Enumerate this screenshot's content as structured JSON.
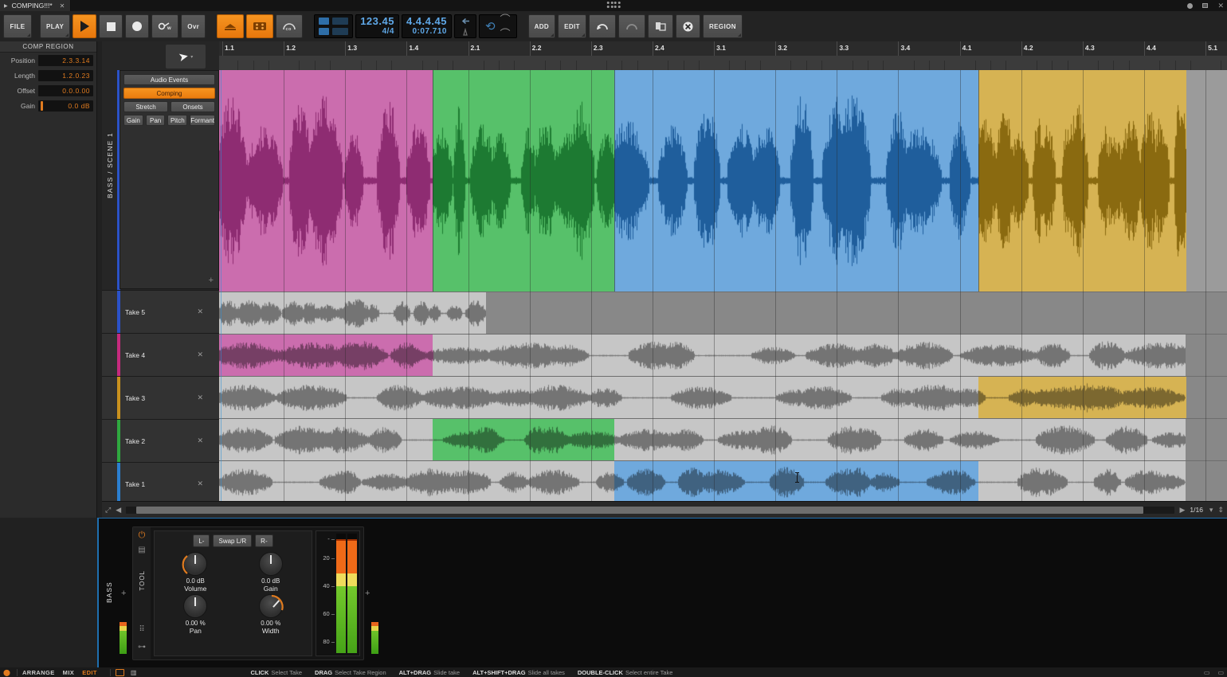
{
  "window": {
    "tab_title": "COMPING!!!*",
    "tab_close": "✕",
    "minimize": "minimize-icon",
    "maximize": "maximize-icon",
    "close": "✕"
  },
  "transport": {
    "file_label": "FILE",
    "play_menu_label": "PLAY",
    "play_icon": "play-icon",
    "stop_icon": "stop-icon",
    "record_icon": "record-icon",
    "precount_label": "w",
    "overdub_label": "Ovr",
    "layers_icon": "take-layers-icon",
    "grid_icon": "grid-editor-icon",
    "arc_icon": "arranger-icon",
    "tempo": "123.45",
    "time_signature": "4/4",
    "position_bars": "4.4.4.45",
    "position_time": "0:07.710",
    "loop_icon": "loop-icon",
    "add_label": "ADD",
    "edit_label": "EDIT",
    "undo_icon": "undo-icon",
    "redo_icon": "redo-icon",
    "duplicate_icon": "duplicate-icon",
    "cancel_icon": "cancel-icon",
    "region_label": "REGION",
    "accent_color": "#ef8a16",
    "lcd_color": "#5fa8e8"
  },
  "inspector": {
    "title": "COMP REGION",
    "fields": [
      {
        "label": "Position",
        "value": "2.3.3.14"
      },
      {
        "label": "Length",
        "value": "1.2.0.23"
      },
      {
        "label": "Offset",
        "value": "0.0.0.00"
      },
      {
        "label": "Gain",
        "value": "0.0 dB"
      }
    ],
    "value_color": "#e07b1f"
  },
  "tool_palette": {
    "buttons": [
      {
        "label": "Audio Events",
        "active": false
      },
      {
        "label": "Comping",
        "active": true
      }
    ],
    "row2": [
      {
        "label": "Stretch",
        "active": false
      },
      {
        "label": "Onsets",
        "active": false
      }
    ],
    "row3": [
      {
        "label": "Gain",
        "active": false
      },
      {
        "label": "Pan",
        "active": false
      },
      {
        "label": "Pitch",
        "active": false
      },
      {
        "label": "Formant",
        "active": false
      }
    ],
    "add_label": "+"
  },
  "track": {
    "name": "BASS / SCENE 1",
    "accent_color": "#2b52c8",
    "cursor_icon": "pointer-cursor-icon"
  },
  "takes": [
    {
      "name": "Take 5",
      "color": "#2b52c8",
      "close": "✕"
    },
    {
      "name": "Take 4",
      "color": "#c62a7e",
      "close": "✕"
    },
    {
      "name": "Take 3",
      "color": "#c9911e",
      "close": "✕"
    },
    {
      "name": "Take 2",
      "color": "#2fa83f",
      "close": "✕"
    },
    {
      "name": "Take 1",
      "color": "#2b7fd0",
      "close": "✕"
    }
  ],
  "ruler": {
    "labels": [
      "1.1",
      "1.2",
      "1.3",
      "1.4",
      "2.1",
      "2.2",
      "2.3",
      "2.4",
      "3.1",
      "3.2",
      "3.3",
      "3.4",
      "4.1",
      "4.2",
      "4.3",
      "4.4",
      "5.1"
    ]
  },
  "comp_segments": [
    {
      "take": "Take 4",
      "fill": "#cb6dae",
      "wave": "#8e2c72",
      "start_pct": 0.0,
      "end_pct": 21.2
    },
    {
      "take": "Take 2",
      "fill": "#57c16a",
      "wave": "#1d7a32",
      "start_pct": 21.2,
      "end_pct": 39.2
    },
    {
      "take": "Take 1",
      "fill": "#6fa9dd",
      "wave": "#1f5e9c",
      "start_pct": 39.2,
      "end_pct": 75.3
    },
    {
      "take": "Take 3",
      "fill": "#d6b353",
      "wave": "#8a6a10",
      "start_pct": 75.3,
      "end_pct": 95.9
    }
  ],
  "take_lanes_audio": [
    {
      "name": "Take 5",
      "clip_start_pct": 0.0,
      "clip_end_pct": 26.5,
      "active_start_pct": null,
      "active_end_pct": null,
      "fill": "#2b52c8"
    },
    {
      "name": "Take 4",
      "clip_start_pct": 0.0,
      "clip_end_pct": 95.9,
      "active_start_pct": 0.0,
      "active_end_pct": 21.2,
      "fill": "#cb6dae"
    },
    {
      "name": "Take 3",
      "clip_start_pct": 0.0,
      "clip_end_pct": 95.9,
      "active_start_pct": 75.3,
      "active_end_pct": 95.9,
      "fill": "#d6b353"
    },
    {
      "name": "Take 2",
      "clip_start_pct": 0.0,
      "clip_end_pct": 95.9,
      "active_start_pct": 21.2,
      "active_end_pct": 39.2,
      "fill": "#57c16a"
    },
    {
      "name": "Take 1",
      "clip_start_pct": 0.0,
      "clip_end_pct": 95.9,
      "active_start_pct": 39.2,
      "active_end_pct": 75.3,
      "fill": "#6fa9dd"
    }
  ],
  "scrollbar": {
    "left_icon": "◀",
    "right_icon": "▶",
    "zoom_value": "1/16",
    "zoom_caret": "▾",
    "resize_icon": "resize-icon"
  },
  "mixer": {
    "channel_name": "BASS",
    "rail_label": "TOOL",
    "power_icon": "power-icon",
    "rack_icon": "rack-icon",
    "grid_icon": "grid-icon",
    "link_icon": "link-icon",
    "buttons": [
      {
        "label": "L-"
      },
      {
        "label": "Swap L/R"
      },
      {
        "label": "R-"
      }
    ],
    "knobs": [
      {
        "value": "0.0 dB",
        "label": "Volume"
      },
      {
        "value": "0.0 dB",
        "label": "Gain"
      },
      {
        "value": "0.00 %",
        "label": "Pan"
      },
      {
        "value": "0.00 %",
        "label": "Width"
      }
    ],
    "meter_scale": [
      "20",
      "40",
      "60",
      "80"
    ],
    "meter_top_mark": "-",
    "add_left": "+",
    "add_right": "+"
  },
  "statusbar": {
    "tabs": [
      {
        "label": "ARRANGE",
        "active": false
      },
      {
        "label": "MIX",
        "active": false
      },
      {
        "label": "EDIT",
        "active": true
      }
    ],
    "hints": [
      {
        "key": "CLICK",
        "action": "Select Take"
      },
      {
        "key": "DRAG",
        "action": "Select Take Region"
      },
      {
        "key": "ALT+DRAG",
        "action": "Slide take"
      },
      {
        "key": "ALT+SHIFT+DRAG",
        "action": "Slide all takes"
      },
      {
        "key": "DOUBLE-CLICK",
        "action": "Select entire Take"
      }
    ]
  }
}
